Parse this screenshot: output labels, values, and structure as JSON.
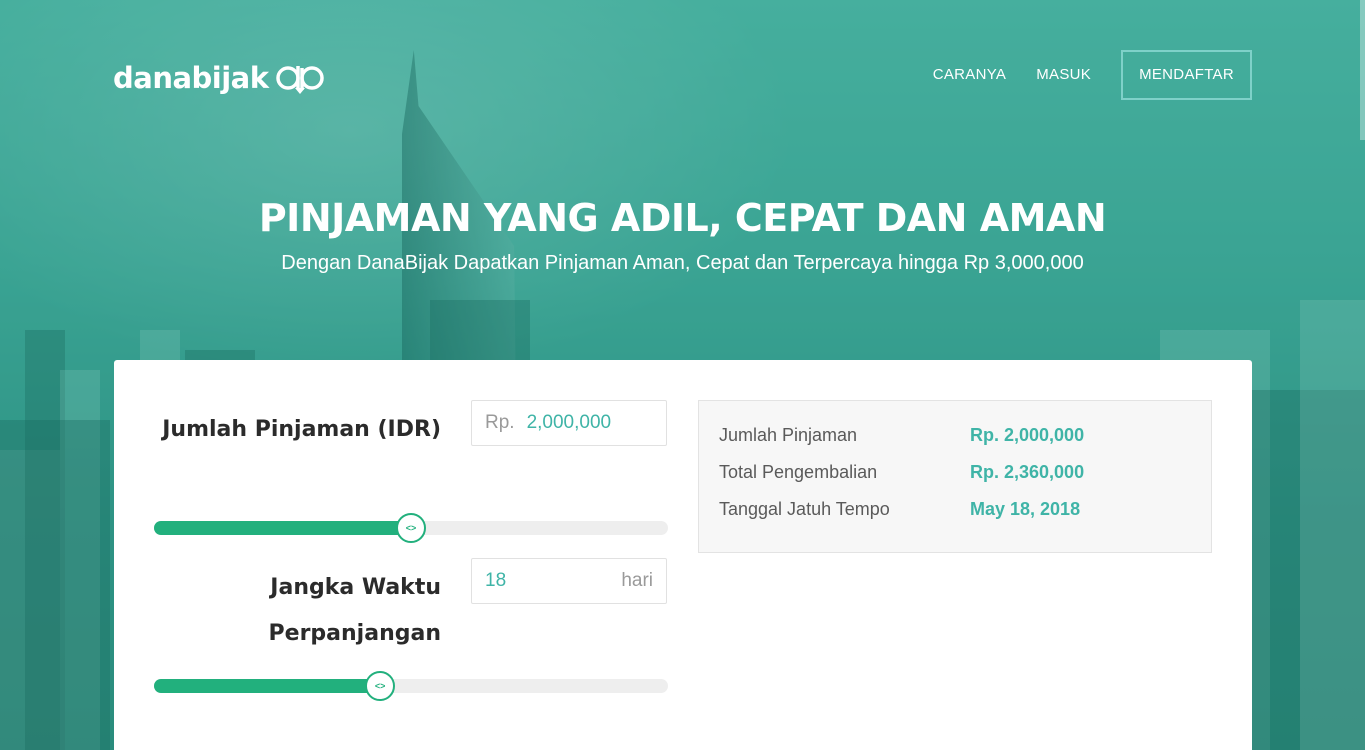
{
  "brand": {
    "name": "danabijak",
    "logo_icon": "danabijak-logo-icon"
  },
  "nav": {
    "links": [
      "CARANYA",
      "MASUK"
    ],
    "signup_label": "MENDAFTAR"
  },
  "hero": {
    "title": "PINJAMAN YANG ADIL, CEPAT DAN AMAN",
    "subtitle": "Dengan DanaBijak Dapatkan Pinjaman Aman, Cepat dan Terpercaya hingga Rp 3,000,000"
  },
  "calculator": {
    "amount": {
      "label": "Jumlah Pinjaman (IDR)",
      "prefix": "Rp.",
      "value": "2,000,000",
      "slider_fraction": 0.5
    },
    "tenor": {
      "label": "Jangka Waktu Perpanjangan",
      "value": "18",
      "suffix": "hari",
      "slider_fraction": 0.44
    },
    "slider_thumb_glyph": "<>"
  },
  "summary": {
    "rows": [
      {
        "label": "Jumlah Pinjaman",
        "value": "Rp. 2,000,000"
      },
      {
        "label": "Total Pengembalian",
        "value": "Rp. 2,360,000"
      },
      {
        "label": "Tanggal Jatuh Tempo",
        "value": "May 18, 2018"
      }
    ]
  },
  "colors": {
    "accent": "#3fb4a7",
    "slider": "#22b07d",
    "hero_bg": "#3fa596"
  }
}
